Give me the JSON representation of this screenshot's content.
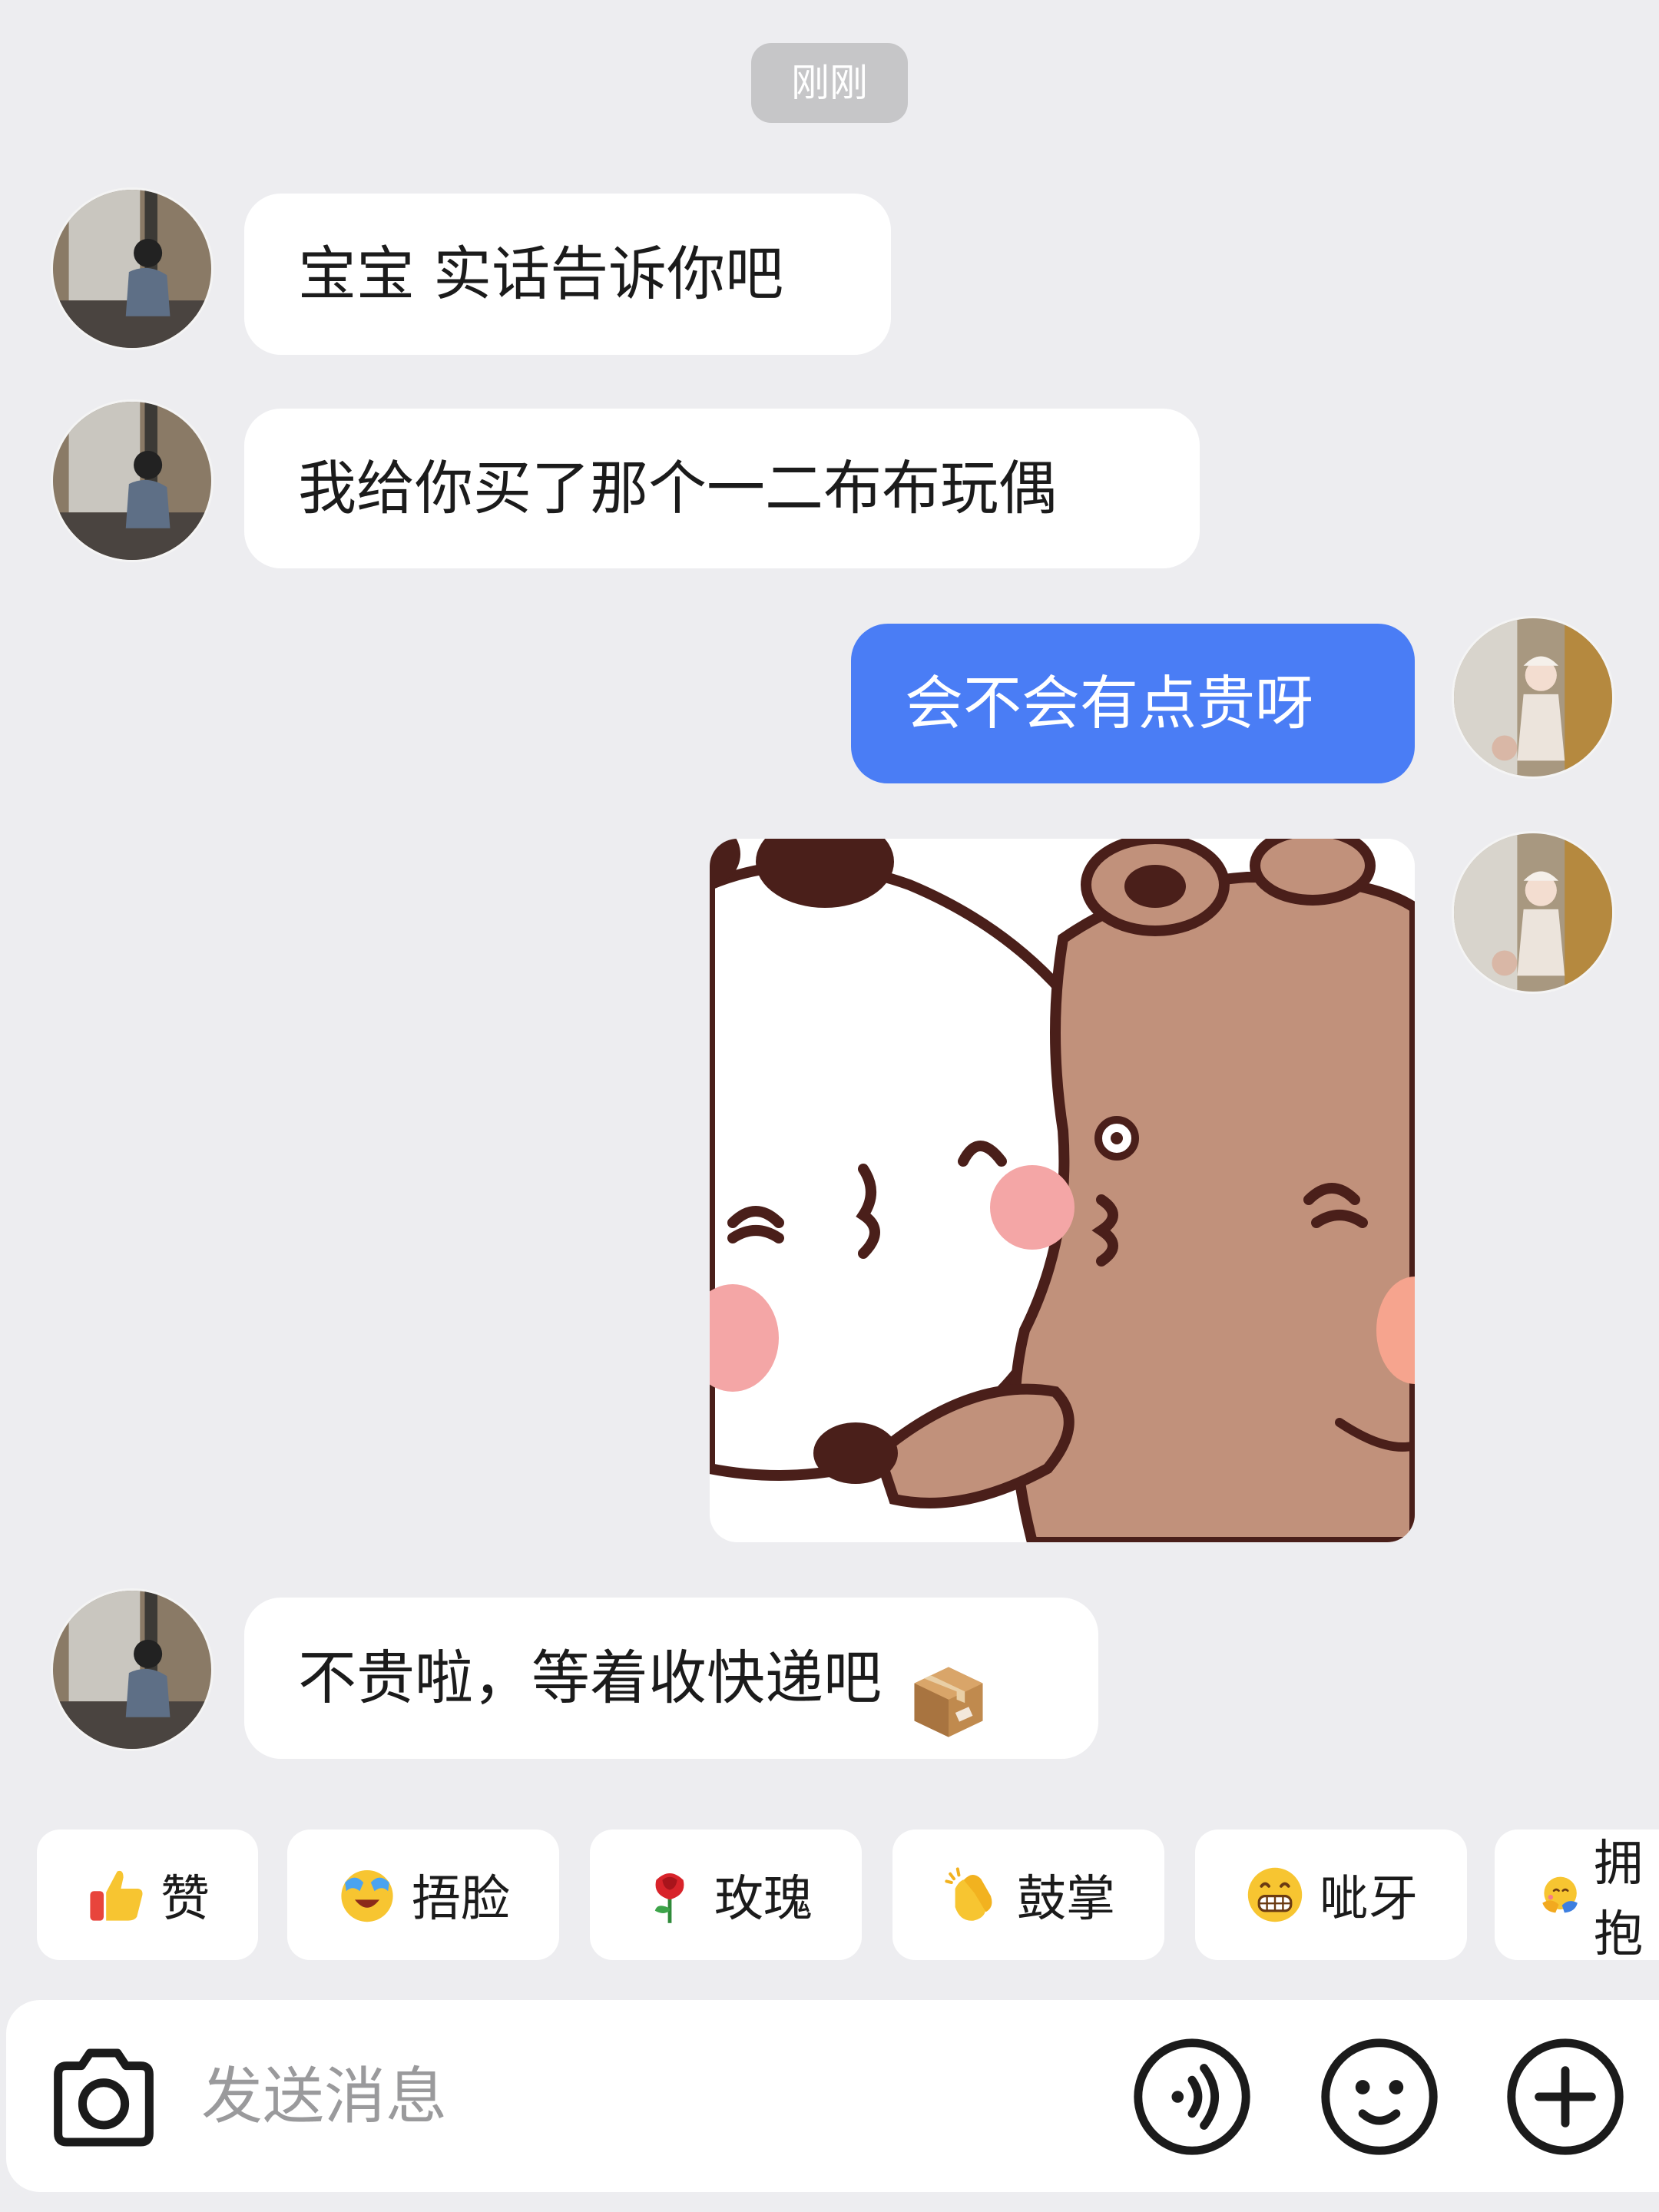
{
  "timestamp": "刚刚",
  "messages": [
    {
      "side": "in",
      "text": "宝宝 实话告诉你吧"
    },
    {
      "side": "in",
      "text": "我给你买了那个一二布布玩偶"
    },
    {
      "side": "out",
      "text": "会不会有点贵呀"
    },
    {
      "side": "out",
      "type": "sticker",
      "sticker": "bears-kiss-sticker"
    },
    {
      "side": "in",
      "text": "不贵啦，等着收快递吧"
    }
  ],
  "reactions": [
    {
      "emoji": "thumbs-up-icon",
      "label": "赞"
    },
    {
      "emoji": "face-palm-laugh-icon",
      "label": "捂脸"
    },
    {
      "emoji": "rose-icon",
      "label": "玫瑰"
    },
    {
      "emoji": "clapping-hands-icon",
      "label": "鼓掌"
    },
    {
      "emoji": "grinning-teeth-icon",
      "label": "呲牙"
    },
    {
      "emoji": "hug-icon",
      "label": "拥抱"
    }
  ],
  "input": {
    "placeholder": "发送消息"
  },
  "colors": {
    "background": "#ededf0",
    "incoming_bubble": "#ffffff",
    "outgoing_bubble": "#4a7df5"
  }
}
